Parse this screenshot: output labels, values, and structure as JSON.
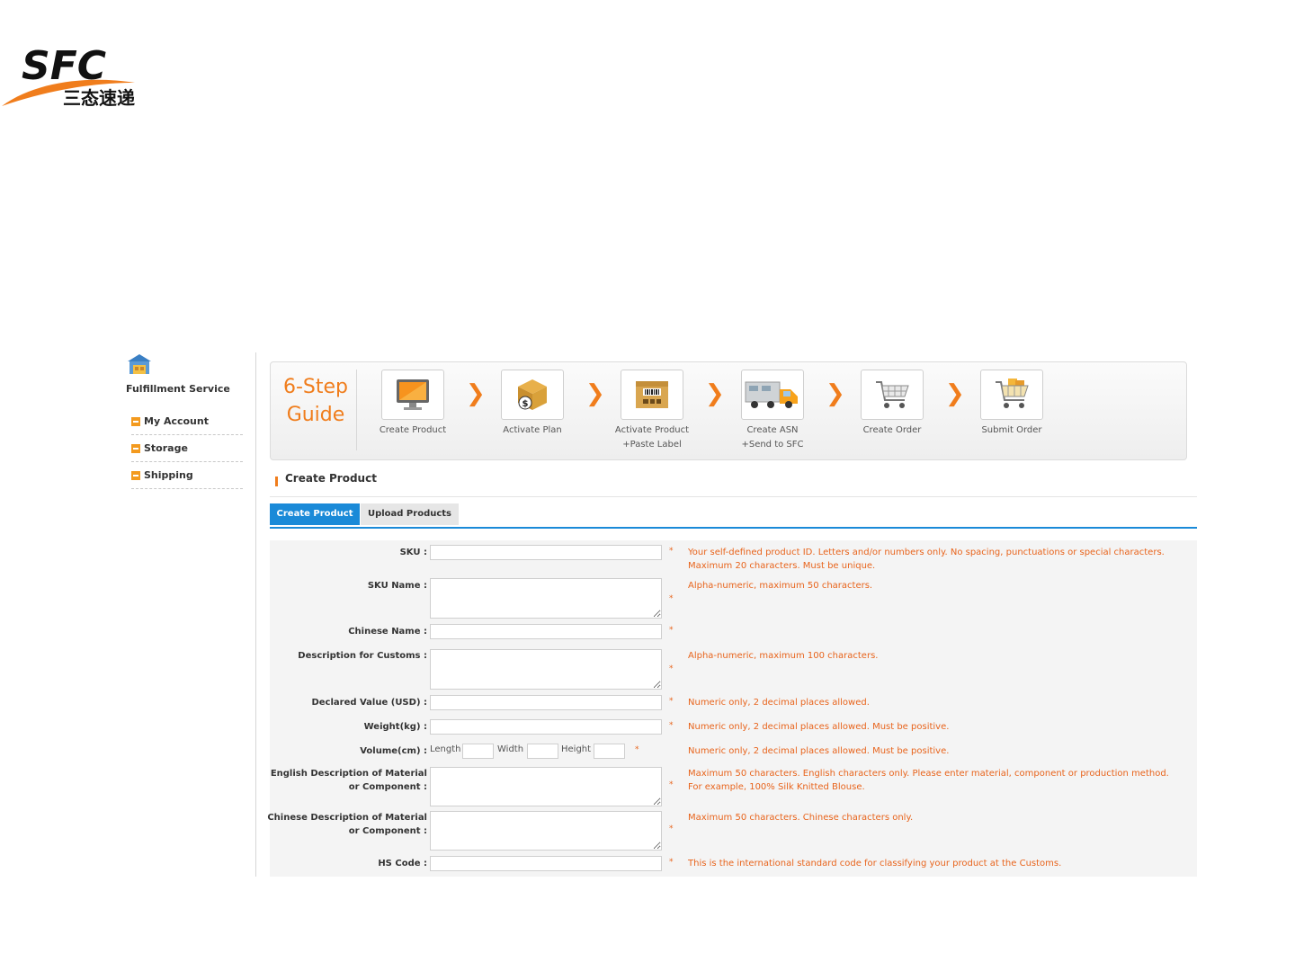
{
  "logo": {
    "brand_text": "SFC",
    "chinese_text": "三态速递"
  },
  "sidebar": {
    "title": "Fulfillment Service",
    "items": [
      {
        "label": "My Account"
      },
      {
        "label": "Storage"
      },
      {
        "label": "Shipping"
      }
    ]
  },
  "guide": {
    "title_line1": "6-Step",
    "title_line2": "Guide",
    "steps": [
      {
        "label": "Create Product",
        "label2": "",
        "icon": "monitor-icon"
      },
      {
        "label": "Activate Plan",
        "label2": "",
        "icon": "money-box-icon"
      },
      {
        "label": "Activate Product",
        "label2": "+Paste Label",
        "icon": "barcode-box-icon"
      },
      {
        "label": "Create ASN",
        "label2": "+Send to SFC",
        "icon": "truck-icon"
      },
      {
        "label": "Create Order",
        "label2": "",
        "icon": "cart-icon"
      },
      {
        "label": "Submit Order",
        "label2": "",
        "icon": "full-cart-icon"
      }
    ],
    "arrow": "❯"
  },
  "section": {
    "title": "Create Product"
  },
  "tabs": [
    {
      "label": "Create Product",
      "active": true
    },
    {
      "label": "Upload Products",
      "active": false
    }
  ],
  "form": {
    "required_mark": "*",
    "sku": {
      "label": "SKU :",
      "hint1": "Your self-defined product ID. Letters and/or numbers only. No spacing, punctuations or special characters.",
      "hint2": "Maximum 20 characters. Must be unique."
    },
    "sku_name": {
      "label": "SKU Name :",
      "hint": "Alpha-numeric, maximum 50 characters."
    },
    "chinese_name": {
      "label": "Chinese Name :"
    },
    "desc_customs": {
      "label": "Description for Customs :",
      "hint": "Alpha-numeric, maximum 100 characters."
    },
    "declared_value": {
      "label": "Declared Value (USD) :",
      "hint": "Numeric only, 2 decimal places allowed."
    },
    "weight": {
      "label": "Weight(kg) :",
      "hint": "Numeric only, 2 decimal places allowed. Must be positive."
    },
    "volume": {
      "label": "Volume(cm) :",
      "length": "Length",
      "width": "Width",
      "height": "Height",
      "hint": "Numeric only, 2 decimal places allowed. Must be positive."
    },
    "eng_desc": {
      "label1": "English Description of Material",
      "label2": "or Component :",
      "hint1": "Maximum 50 characters. English characters only. Please enter material, component or production method.",
      "hint2": "For example, 100% Silk Knitted Blouse."
    },
    "chn_desc": {
      "label1": "Chinese Description of Material",
      "label2": "or Component :",
      "hint": "Maximum 50 characters. Chinese characters only."
    },
    "hs_code": {
      "label": "HS Code :",
      "hint": "This is the international standard code for classifying your product at the Customs."
    }
  },
  "colors": {
    "accent_orange": "#f07d1c",
    "tab_blue": "#1a8ad8",
    "hint_red": "#e8641c"
  }
}
